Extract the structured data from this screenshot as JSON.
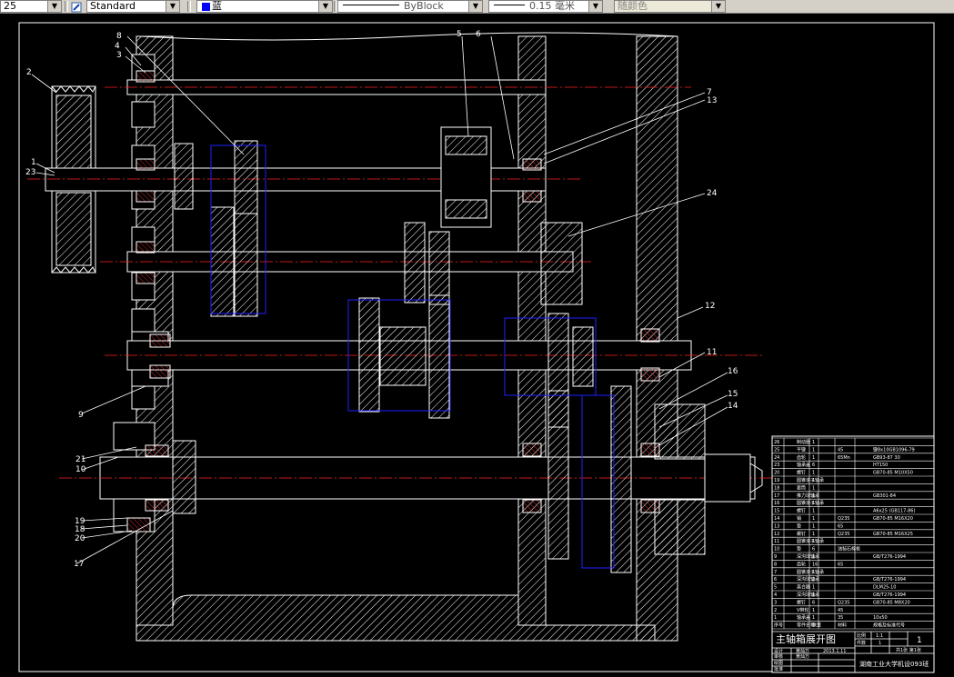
{
  "toolbar": {
    "scale_value": "25",
    "text_style": "Standard",
    "color": "蓝",
    "color_hex": "#0000ff",
    "linetype": "ByBlock",
    "lineweight": "0.15 毫米",
    "plot_style": "随颜色"
  },
  "callouts": [
    "1",
    "2",
    "3",
    "4",
    "5",
    "6",
    "7",
    "8",
    "9",
    "10",
    "11",
    "12",
    "13",
    "14",
    "15",
    "16",
    "17",
    "18",
    "19",
    "20",
    "21",
    "23",
    "24"
  ],
  "title_block": {
    "title": "主轴箱展开图",
    "school": "湖南工业大学机设093班",
    "scale_label": "比例",
    "scale_value": "1:1",
    "qty_label": "件数",
    "qty_value": "1",
    "weight_value": "1",
    "sheet": "共1张 第1张",
    "designer_label": "设计",
    "designer": "黄灿万",
    "date": "2013.1.11",
    "checker_label": "审核",
    "approver_label": "批准",
    "drafter_label": "绘图",
    "drafter": "黄灿万",
    "header": {
      "no": "序号",
      "name": "零件名称",
      "qty": "数量",
      "material": "材料",
      "remark": "规格及标准代号"
    },
    "rows": [
      {
        "no": "26",
        "name": "制动器",
        "qty": "1",
        "material": "",
        "remark": ""
      },
      {
        "no": "25",
        "name": "平键",
        "qty": "1",
        "material": "45",
        "remark": "键8x10GB1096-79"
      },
      {
        "no": "24",
        "name": "齿轮",
        "qty": "1",
        "material": "65Mn",
        "remark": "GB93-87 30"
      },
      {
        "no": "23",
        "name": "轴承盖",
        "qty": "6",
        "material": "",
        "remark": "HT150"
      },
      {
        "no": "20",
        "name": "螺钉",
        "qty": "1",
        "material": "",
        "remark": "GB70-85 M10X50"
      },
      {
        "no": "19",
        "name": "圆锥滚子轴承",
        "qty": "1",
        "material": "",
        "remark": ""
      },
      {
        "no": "18",
        "name": "套筒",
        "qty": "1",
        "material": "",
        "remark": ""
      },
      {
        "no": "17",
        "name": "推力球轴承",
        "qty": "1",
        "material": "",
        "remark": "GB301-84"
      },
      {
        "no": "16",
        "name": "圆锥滚子轴承",
        "qty": "1",
        "material": "",
        "remark": ""
      },
      {
        "no": "15",
        "name": "螺钉",
        "qty": "1",
        "material": "",
        "remark": "A6x25 (GB117-86)"
      },
      {
        "no": "14",
        "name": "销",
        "qty": "1",
        "material": "Q235",
        "remark": "GB70-85 M16X20"
      },
      {
        "no": "13",
        "name": "垫",
        "qty": "1",
        "material": "65",
        "remark": ""
      },
      {
        "no": "12",
        "name": "螺钉",
        "qty": "1",
        "material": "Q235",
        "remark": "GB70-85 M16X25"
      },
      {
        "no": "11",
        "name": "圆锥滚子轴承",
        "qty": "1",
        "material": "",
        "remark": ""
      },
      {
        "no": "10",
        "name": "垫",
        "qty": "6",
        "material": "油毡石棉板",
        "remark": ""
      },
      {
        "no": "9",
        "name": "深沟球轴承",
        "qty": "1",
        "material": "",
        "remark": "GB/T276-1994"
      },
      {
        "no": "8",
        "name": "齿轮",
        "qty": "16",
        "material": "65",
        "remark": ""
      },
      {
        "no": "7",
        "name": "圆锥滚子轴承",
        "qty": "1",
        "material": "",
        "remark": ""
      },
      {
        "no": "6",
        "name": "深沟球轴承",
        "qty": "2",
        "material": "",
        "remark": "GB/T276-1994"
      },
      {
        "no": "5",
        "name": "离合器",
        "qty": "1",
        "material": "",
        "remark": "DLM25-10"
      },
      {
        "no": "4",
        "name": "深沟球轴承",
        "qty": "1",
        "material": "",
        "remark": "GB/T276-1994"
      },
      {
        "no": "3",
        "name": "螺钉",
        "qty": "6",
        "material": "Q235",
        "remark": "GB70-85 M8X20"
      },
      {
        "no": "2",
        "name": "V带轮",
        "qty": "1",
        "material": "45",
        "remark": ""
      },
      {
        "no": "1",
        "name": "轴承盖",
        "qty": "1",
        "material": "35",
        "remark": "10x50"
      }
    ]
  }
}
